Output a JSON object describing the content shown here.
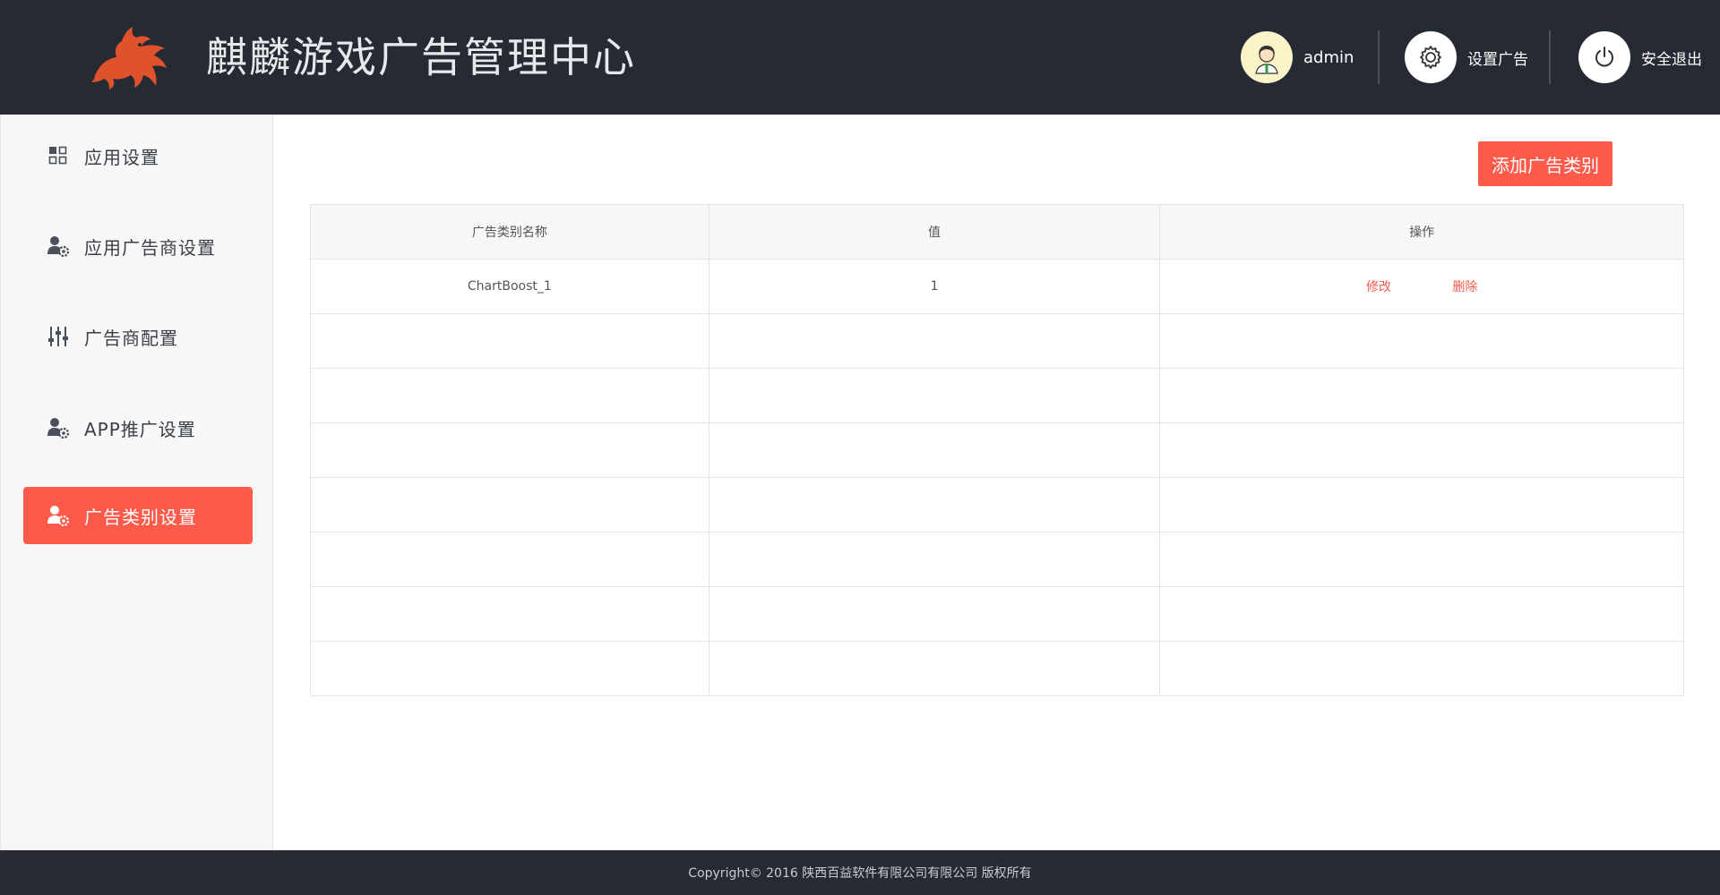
{
  "header": {
    "title": "麒麟游戏广告管理中心",
    "user": {
      "name": "admin",
      "icon": "avatar-icon"
    },
    "settings": {
      "label": "设置广告",
      "icon": "gear-icon"
    },
    "logout": {
      "label": "安全退出",
      "icon": "power-icon"
    }
  },
  "sidebar": {
    "items": [
      {
        "label": "应用设置",
        "icon": "grid-icon",
        "active": false
      },
      {
        "label": "应用广告商设置",
        "icon": "user-gear-icon",
        "active": false
      },
      {
        "label": "广告商配置",
        "icon": "sliders-icon",
        "active": false
      },
      {
        "label": "APP推广设置",
        "icon": "user-gear-icon",
        "active": false
      },
      {
        "label": "广告类别设置",
        "icon": "user-gear-icon",
        "active": true
      }
    ]
  },
  "main": {
    "add_button": "添加广告类别",
    "table": {
      "headers": [
        "广告类别名称",
        "值",
        "操作"
      ],
      "rows": [
        {
          "name": "ChartBoost_1",
          "value": "1",
          "edit": "修改",
          "delete": "删除"
        }
      ]
    }
  },
  "footer": {
    "text": "Copyright©  2016  陕西百益软件有限公司有限公司 版权所有"
  },
  "colors": {
    "header_bg": "#252a33",
    "accent": "#fc5a4b",
    "sidebar_bg": "#f7f7f7"
  }
}
